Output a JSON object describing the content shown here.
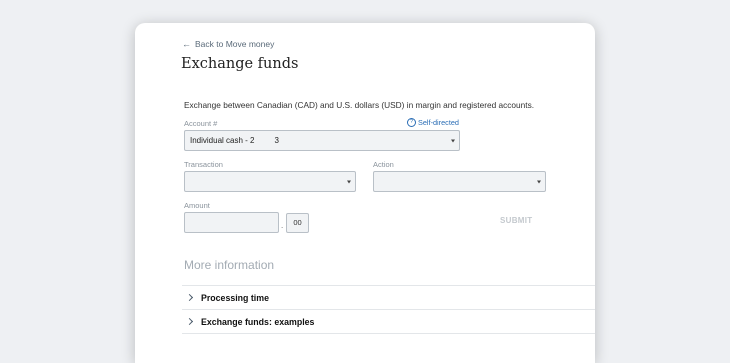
{
  "nav": {
    "back_label": "Back to Move money",
    "back_icon": "arrow-left-icon"
  },
  "page": {
    "title": "Exchange funds",
    "description": "Exchange between Canadian (CAD) and U.S. dollars (USD) in margin and registered accounts."
  },
  "account": {
    "label": "Account #",
    "help_link": "Self-directed",
    "selected_value_prefix": "Individual cash - 2",
    "selected_value_suffix": "3"
  },
  "transaction": {
    "label": "Transaction",
    "value": ""
  },
  "action": {
    "label": "Action",
    "value": ""
  },
  "amount": {
    "label": "Amount",
    "value": "",
    "separator": ".",
    "cents": "00"
  },
  "submit_label": "SUBMIT",
  "more_info": {
    "heading": "More information",
    "items": [
      {
        "label": "Processing time"
      },
      {
        "label": "Exchange funds: examples"
      }
    ]
  },
  "colors": {
    "background": "#eef0f3",
    "link": "#2a6db5",
    "field_bg": "#f1f3f5",
    "field_border": "#b9c0c7",
    "disabled": "#c4c9ce"
  }
}
